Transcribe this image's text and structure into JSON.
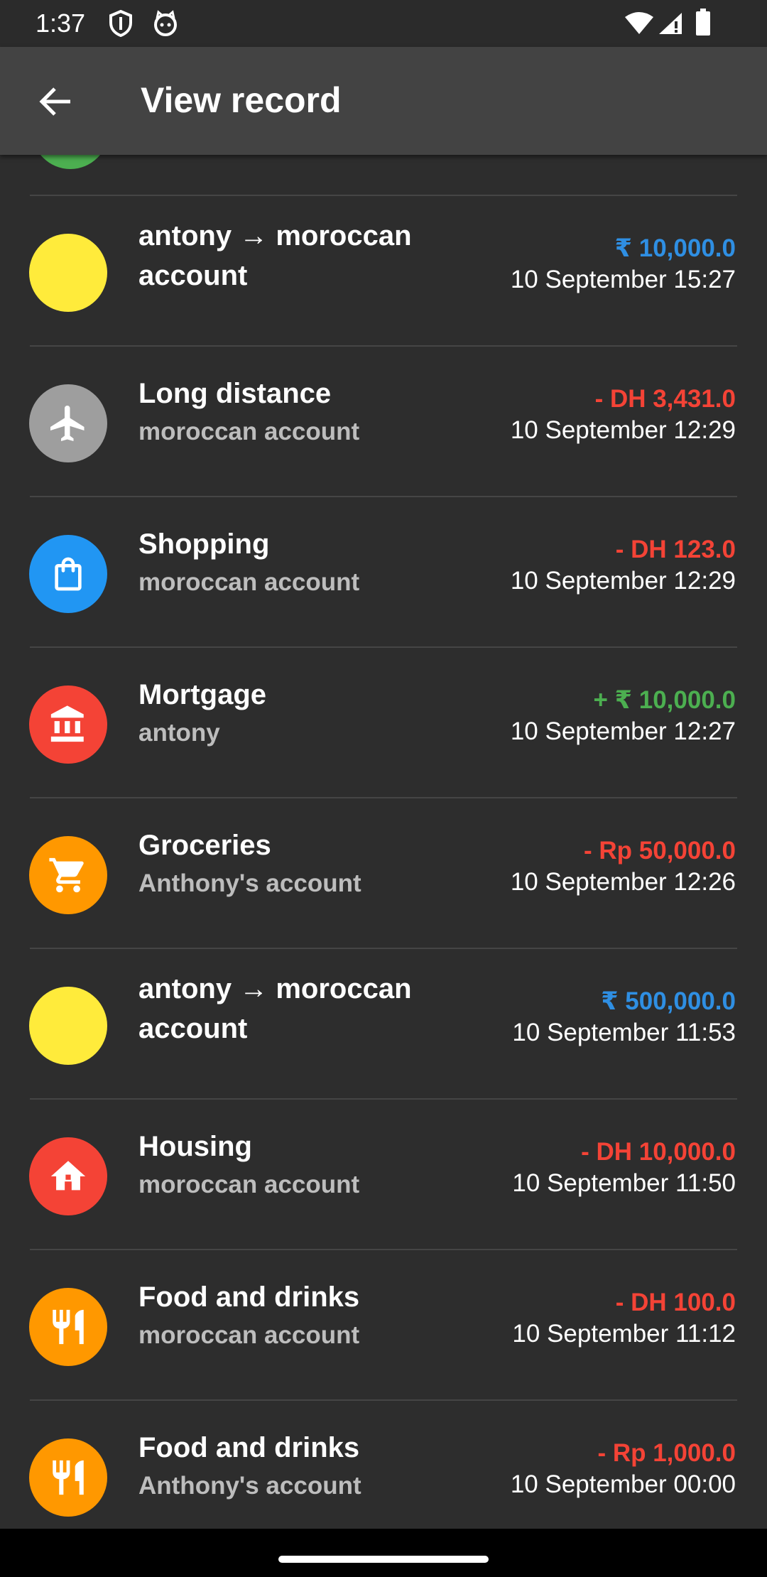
{
  "status": {
    "time": "1:37"
  },
  "app_bar": {
    "title": "View record"
  },
  "records": [
    {
      "title": "antony → moroccan account",
      "subtitle": "",
      "amount": "₹ 10,000.0",
      "amount_color": "#2f8fe3",
      "date": "10 September 15:27",
      "icon": "transfer-icon",
      "icon_bg": "#ffeb3b"
    },
    {
      "title": "Long distance",
      "subtitle": "moroccan account",
      "amount": "- DH 3,431.0",
      "amount_color": "#f44336",
      "date": "10 September 12:29",
      "icon": "airplane-icon",
      "icon_bg": "#9e9e9e"
    },
    {
      "title": "Shopping",
      "subtitle": "moroccan account",
      "amount": "- DH 123.0",
      "amount_color": "#f44336",
      "date": "10 September 12:29",
      "icon": "shopping-bag-icon",
      "icon_bg": "#2196f3"
    },
    {
      "title": "Mortgage",
      "subtitle": "antony",
      "amount": "+ ₹ 10,000.0",
      "amount_color": "#4caf50",
      "date": "10 September 12:27",
      "icon": "bank-icon",
      "icon_bg": "#f44336"
    },
    {
      "title": "Groceries",
      "subtitle": "Anthony's account",
      "amount": "- Rp 50,000.0",
      "amount_color": "#f44336",
      "date": "10 September 12:26",
      "icon": "cart-icon",
      "icon_bg": "#ff9800"
    },
    {
      "title": "antony → moroccan account",
      "subtitle": "",
      "amount": "₹ 500,000.0",
      "amount_color": "#2f8fe3",
      "date": "10 September 11:53",
      "icon": "transfer-icon",
      "icon_bg": "#ffeb3b"
    },
    {
      "title": "Housing",
      "subtitle": "moroccan account",
      "amount": "- DH 10,000.0",
      "amount_color": "#f44336",
      "date": "10 September 11:50",
      "icon": "house-icon",
      "icon_bg": "#f44336"
    },
    {
      "title": "Food and drinks",
      "subtitle": "moroccan account",
      "amount": "- DH 100.0",
      "amount_color": "#f44336",
      "date": "10 September 11:12",
      "icon": "fork-knife-icon",
      "icon_bg": "#ff9800"
    },
    {
      "title": "Food and drinks",
      "subtitle": "Anthony's account",
      "amount": "- Rp 1,000.0",
      "amount_color": "#f44336",
      "date": "10 September 00:00",
      "icon": "fork-knife-icon",
      "icon_bg": "#ff9800"
    }
  ]
}
